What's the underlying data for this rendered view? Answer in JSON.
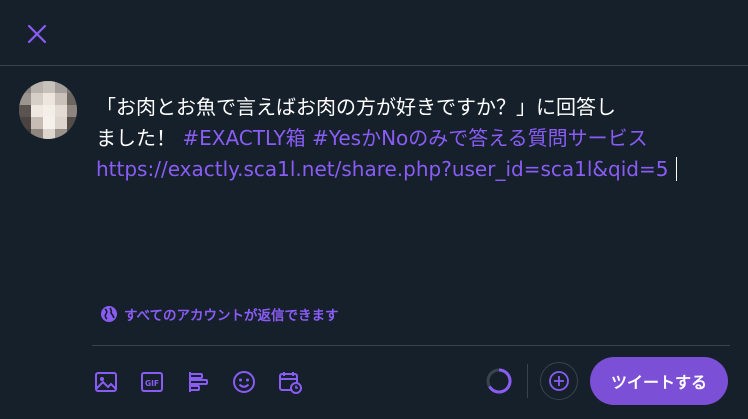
{
  "colors": {
    "background": "#15202b",
    "accent": "#8a5cf6",
    "button": "#7b4fd6",
    "divider": "#38444d",
    "text": "#ffffff"
  },
  "header": {
    "close_icon": "close-icon"
  },
  "composer": {
    "text_line1": "「お肉とお魚で言えばお肉の方が好きですか？」に回答し",
    "text_line2_plain": "ました！ ",
    "hashtag1": "#EXACTLY箱",
    "hashtag2": "#YesかNoのみで答える質問サービス",
    "link": "https://exactly.sca1l.net/share.php?user_id=sca1l&qid=5"
  },
  "reply_setting": {
    "icon": "globe-icon",
    "label": "すべてのアカウントが返信できます"
  },
  "toolbar": {
    "tools": [
      "image-icon",
      "gif-icon",
      "poll-icon",
      "emoji-icon",
      "schedule-icon"
    ],
    "add_icon": "plus-icon",
    "tweet_label": "ツイートする"
  }
}
